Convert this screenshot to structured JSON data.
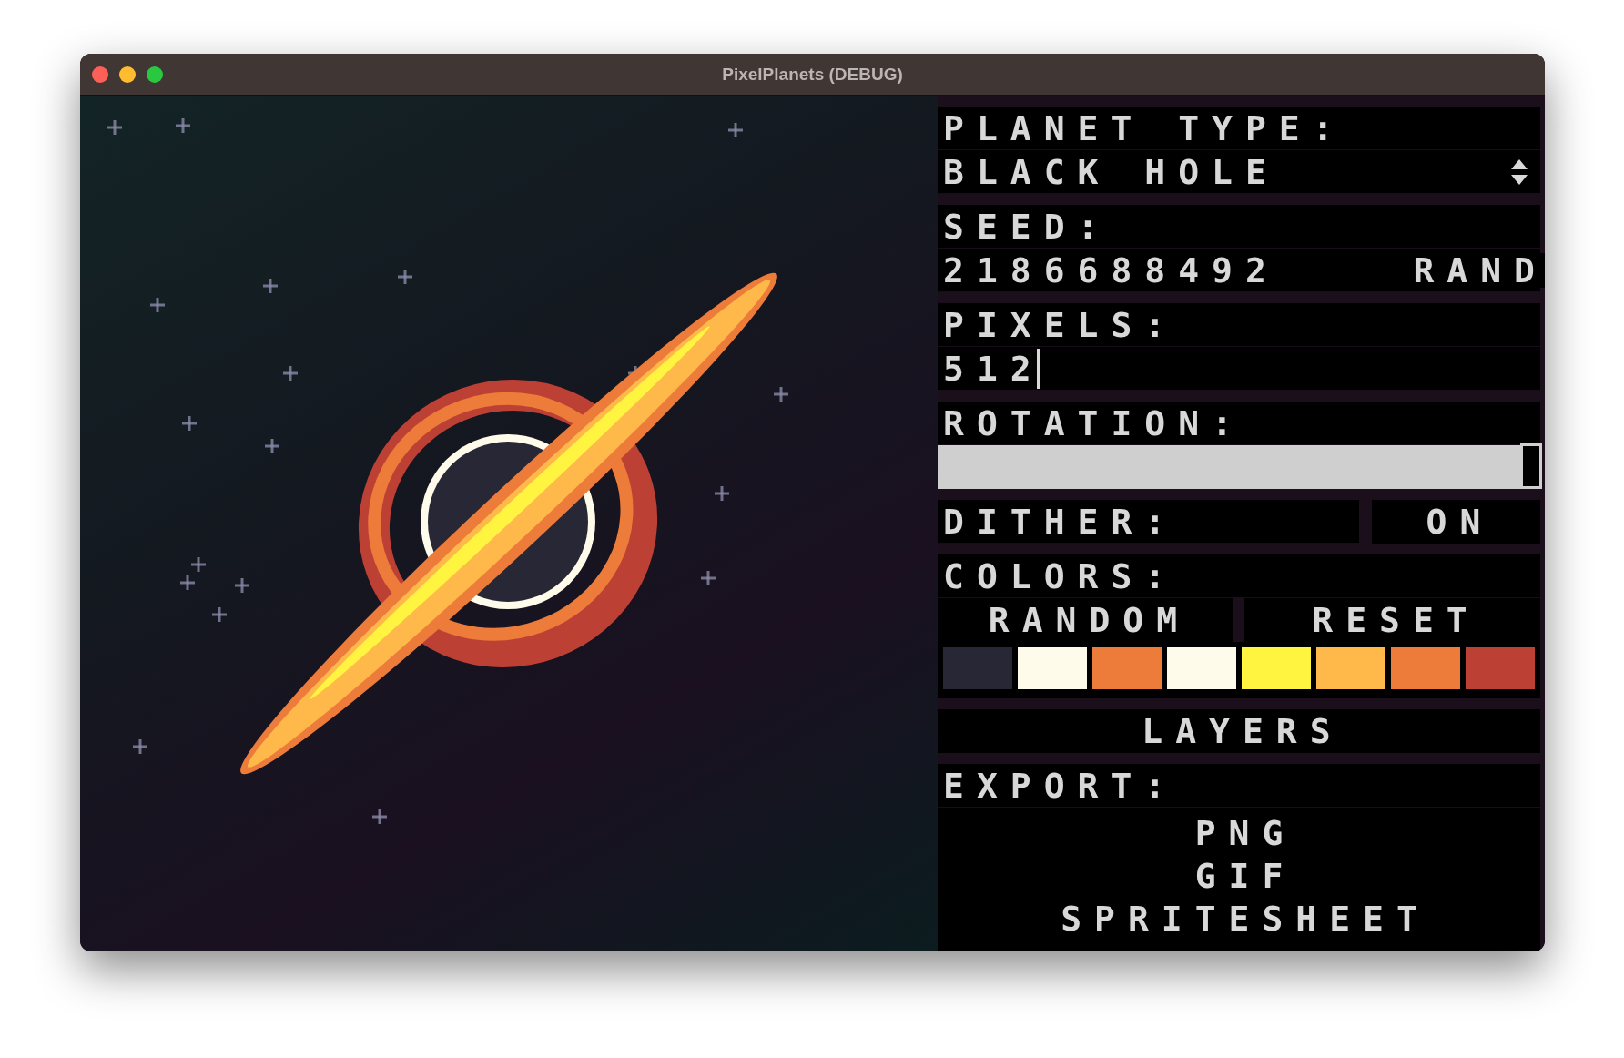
{
  "window": {
    "title": "PixelPlanets (DEBUG)"
  },
  "planet_type": {
    "label": "PLANET TYPE:",
    "value": "BLACK HOLE"
  },
  "seed": {
    "label": "SEED:",
    "value": "2186688492",
    "button": "RAND"
  },
  "pixels": {
    "label": "PIXELS:",
    "value": "512"
  },
  "rotation": {
    "label": "ROTATION:",
    "level": 1
  },
  "dither": {
    "label": "DITHER:",
    "value": "ON"
  },
  "colors": {
    "label": "COLORS:",
    "buttons": [
      "RANDOM",
      "RESET"
    ],
    "swatches": [
      {
        "color": "#272736"
      },
      {
        "color": "#fffbeb"
      },
      {
        "color": "#ed7b39"
      },
      {
        "color": "#fffbeb"
      },
      {
        "color": "#fff540"
      },
      {
        "color": "#ffb84a"
      },
      {
        "color": "#ed7b39"
      },
      {
        "color": "#bd4035"
      }
    ]
  },
  "layers": {
    "label": "LAYERS"
  },
  "export": {
    "label": "EXPORT:",
    "options": [
      "PNG",
      "GIF",
      "SPRITESHEET"
    ]
  }
}
